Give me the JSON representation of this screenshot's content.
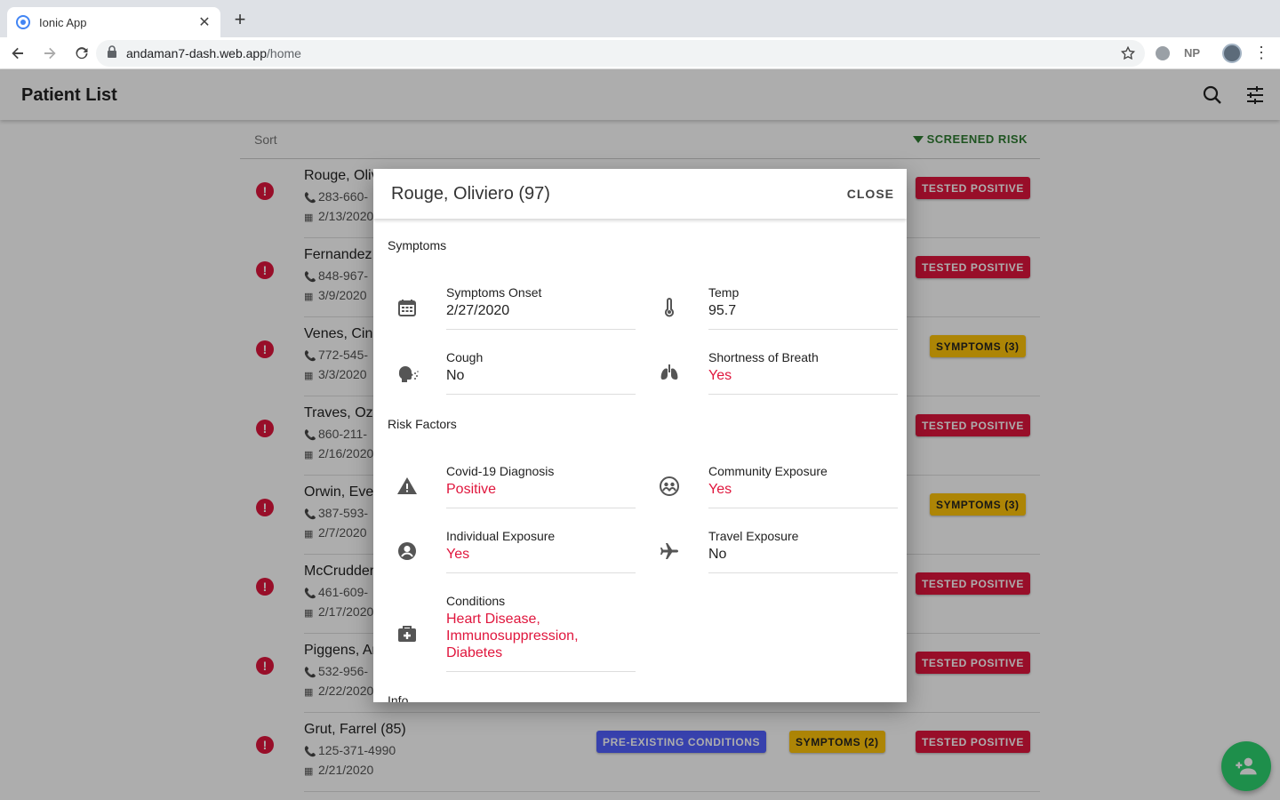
{
  "browser": {
    "tab_title": "Ionic App",
    "url_host": "andaman7-dash.web.app",
    "url_path": "/home",
    "ext_label": "NP"
  },
  "app": {
    "title": "Patient List",
    "sort_label": "Sort",
    "sort_key": "SCREENED RISK"
  },
  "patients": [
    {
      "name": "Rouge, Olivi",
      "phone": "283-660-",
      "date": "2/13/2020",
      "badges": [
        "TESTED POSITIVE"
      ]
    },
    {
      "name": "Fernandez,",
      "phone": "848-967-",
      "date": "3/9/2020",
      "badges": [
        "TESTED POSITIVE"
      ]
    },
    {
      "name": "Venes, Cinc",
      "phone": "772-545-",
      "date": "3/3/2020",
      "badges": [
        "SYMPTOMS (3)"
      ]
    },
    {
      "name": "Traves, Ozz",
      "phone": "860-211-",
      "date": "2/16/2020",
      "badges": [
        "TESTED POSITIVE"
      ]
    },
    {
      "name": "Orwin, Evel",
      "phone": "387-593-",
      "date": "2/7/2020",
      "badges": [
        "SYMPTOMS (3)"
      ]
    },
    {
      "name": "McCrudder",
      "phone": "461-609-",
      "date": "2/17/2020",
      "badges": [
        "TESTED POSITIVE"
      ]
    },
    {
      "name": "Piggens, Ar",
      "phone": "532-956-",
      "date": "2/22/2020",
      "badges": [
        "TESTED POSITIVE"
      ]
    },
    {
      "name": "Grut, Farrel (85)",
      "phone": "125-371-4990",
      "date": "2/21/2020",
      "badges": [
        "PRE-EXISTING CONDITIONS",
        "SYMPTOMS (2)",
        "TESTED POSITIVE"
      ]
    }
  ],
  "modal": {
    "title": "Rouge, Oliviero (97)",
    "close_label": "CLOSE",
    "symptoms_heading": "Symptoms",
    "risk_heading": "Risk Factors",
    "info_heading": "Info",
    "fields": {
      "onset": {
        "label": "Symptoms Onset",
        "value": "2/27/2020"
      },
      "temp": {
        "label": "Temp",
        "value": "95.7"
      },
      "cough": {
        "label": "Cough",
        "value": "No"
      },
      "sob": {
        "label": "Shortness of Breath",
        "value": "Yes"
      },
      "diagnosis": {
        "label": "Covid-19 Diagnosis",
        "value": "Positive"
      },
      "community": {
        "label": "Community Exposure",
        "value": "Yes"
      },
      "individual": {
        "label": "Individual Exposure",
        "value": "Yes"
      },
      "travel": {
        "label": "Travel Exposure",
        "value": "No"
      },
      "conditions": {
        "label": "Conditions",
        "value": "Heart Disease, Immunosuppression, Diabetes"
      }
    }
  },
  "colors": {
    "danger": "#e0163d",
    "warning": "#ffc409",
    "tertiary": "#5260ff",
    "success": "#2dd36f",
    "sort_accent": "#2e7d32"
  }
}
